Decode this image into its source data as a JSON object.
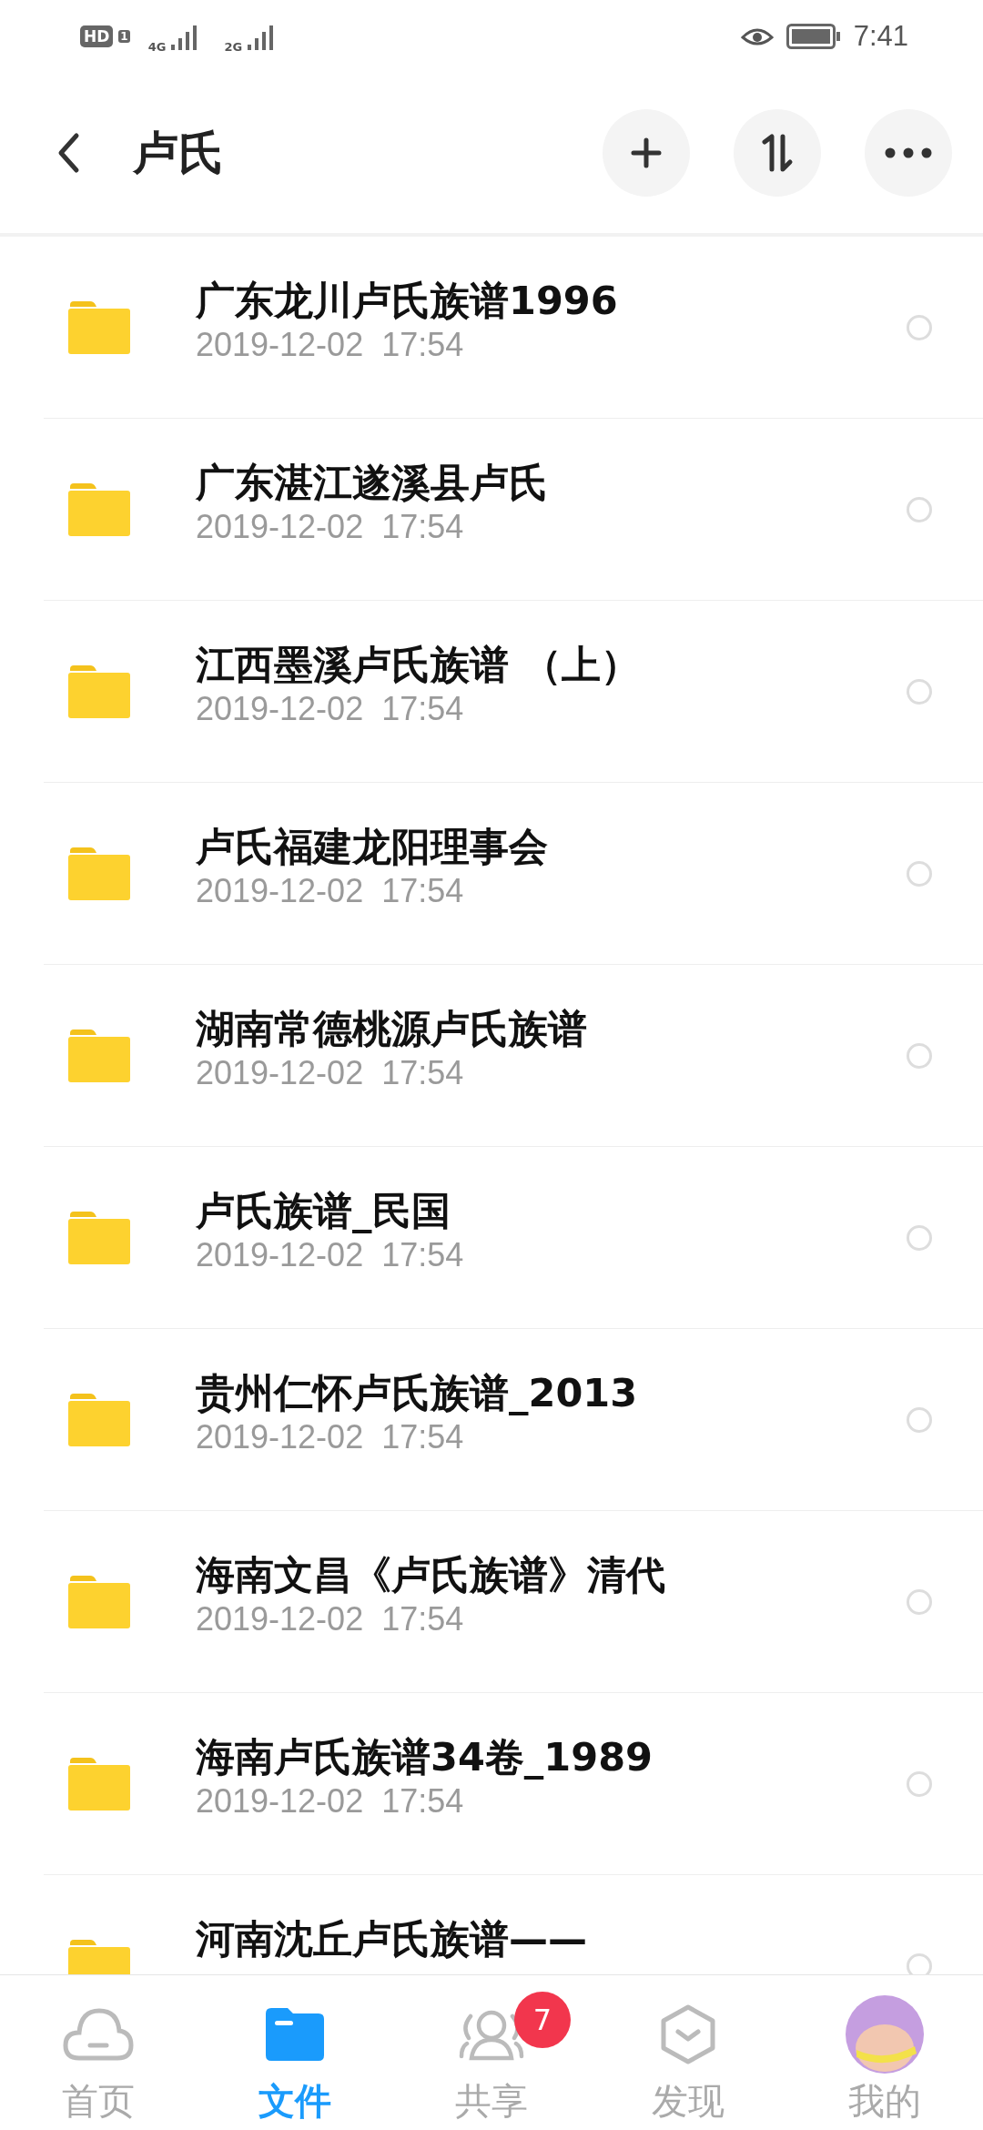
{
  "status_bar": {
    "hd": "HD",
    "sim": "1",
    "networks": [
      "4G",
      "2G"
    ],
    "time": "7:41"
  },
  "header": {
    "title": "卢氏"
  },
  "files": [
    {
      "name": "广东龙川卢氏族谱1996",
      "date": "2019-12-02  17:54",
      "selected": false
    },
    {
      "name": "广东湛江遂溪县卢氏",
      "date": "2019-12-02  17:54",
      "selected": false
    },
    {
      "name": "江西墨溪卢氏族谱 （上）",
      "date": "2019-12-02  17:54",
      "selected": false
    },
    {
      "name": "卢氏福建龙阳理事会",
      "date": "2019-12-02  17:54",
      "selected": false
    },
    {
      "name": "湖南常德桃源卢氏族谱",
      "date": "2019-12-02  17:54",
      "selected": false
    },
    {
      "name": "卢氏族谱_民国",
      "date": "2019-12-02  17:54",
      "selected": false
    },
    {
      "name": "贵州仁怀卢氏族谱_2013",
      "date": "2019-12-02  17:54",
      "selected": false
    },
    {
      "name": "海南文昌《卢氏族谱》清代",
      "date": "2019-12-02  17:54",
      "selected": false
    },
    {
      "name": "海南卢氏族谱34卷_1989",
      "date": "2019-12-02  17:54",
      "selected": false
    },
    {
      "name": "河南沈丘卢氏族谱——",
      "selected": false
    }
  ],
  "nav": [
    {
      "kind": "home",
      "label": "首页",
      "selected": false
    },
    {
      "kind": "files",
      "label": "文件",
      "selected": true
    },
    {
      "kind": "share",
      "label": "共享",
      "selected": false,
      "badge": "7"
    },
    {
      "kind": "discover",
      "label": "发现",
      "selected": false
    },
    {
      "kind": "me",
      "label": "我的",
      "selected": false
    }
  ]
}
